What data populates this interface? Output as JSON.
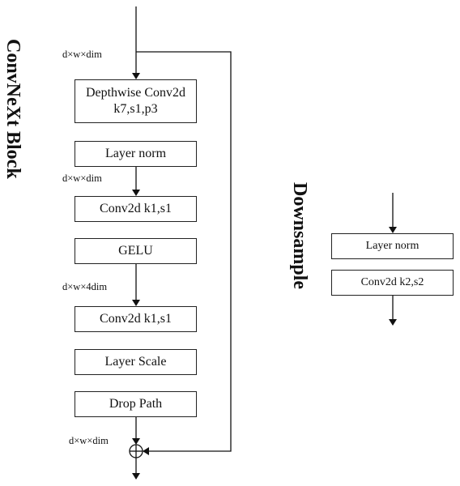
{
  "block_title": "ConvNeXt Block",
  "downsample_title": "Downsample",
  "block_layers": [
    "Depthwise Conv2d k7,s1,p3",
    "Layer norm",
    "Conv2d k1,s1",
    "GELU",
    "Conv2d k1,s1",
    "Layer Scale",
    "Drop Path"
  ],
  "depthwise": {
    "line1": "Depthwise Conv2d",
    "line2": "k7,s1,p3"
  },
  "shape_labels": [
    "d×w×dim",
    "d×w×dim",
    "d×w×4dim",
    "d×w×dim"
  ],
  "downsample_layers": [
    "Layer norm",
    "Conv2d k2,s2"
  ],
  "add_symbol": "⊕"
}
